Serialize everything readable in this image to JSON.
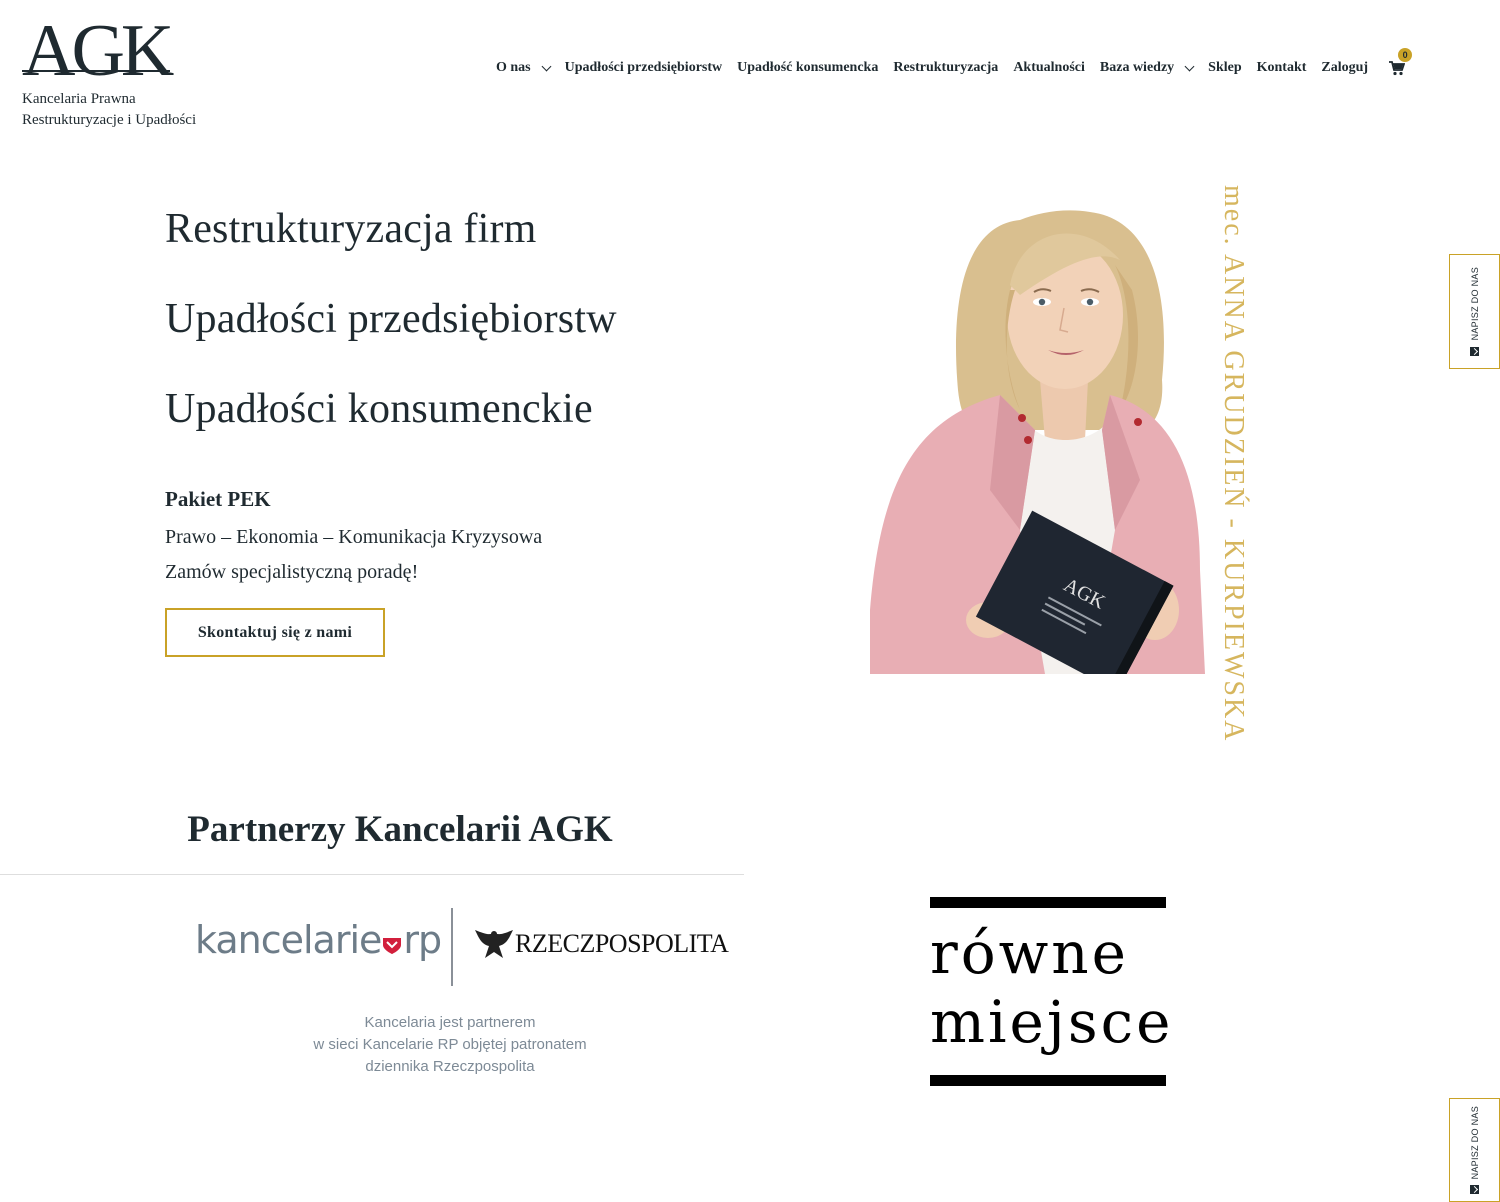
{
  "header": {
    "logo": "AGK",
    "tagline_1": "Kancelaria Prawna",
    "tagline_2": "Restrukturyzacje i Upadłości"
  },
  "nav": {
    "items": [
      {
        "label": "O nas",
        "has_dropdown": true
      },
      {
        "label": "Upadłości przedsiębiorstw"
      },
      {
        "label": "Upadłość konsumencka"
      },
      {
        "label": "Restrukturyzacja"
      },
      {
        "label": "Aktualności"
      },
      {
        "label": "Baza wiedzy",
        "has_dropdown": true
      },
      {
        "label": "Sklep"
      },
      {
        "label": "Kontakt"
      },
      {
        "label": "Zaloguj"
      }
    ],
    "cart_count": "0",
    "cart_icon": "shopping-cart-icon"
  },
  "hero": {
    "titles": [
      "Restrukturyzacja firm",
      "Upadłości przedsiębiorstw",
      "Upadłości konsumenckie"
    ],
    "package_title": "Pakiet PEK",
    "package_line_1": "Prawo – Ekonomia – Komunikacja Kryzysowa",
    "package_line_2": "Zamów specjalistyczną poradę!",
    "cta": "Skontaktuj się z nami",
    "vertical_name": "mec. ANNA GRUDZIEŃ - KURPIEWSKA",
    "book_logo": "AGK"
  },
  "side_tabs": {
    "label": "NAPISZ DO NAS",
    "icon": "send-icon"
  },
  "partners": {
    "title": "Partnerzy Kancelarii AGK",
    "krp_logo_left": "kancelarie",
    "krp_logo_right": "rp",
    "rz_logo": "RZECZPOSPOLITA",
    "caption": [
      "Kancelaria jest partnerem",
      "w sieci Kancelarie RP objętej patronatem",
      "dziennika Rzeczpospolita"
    ],
    "rm_line_1": "równe",
    "rm_line_2": "miejsce"
  },
  "colors": {
    "accent": "#c9a227",
    "text": "#1f2a30",
    "blazer": "#e8aeb4"
  }
}
